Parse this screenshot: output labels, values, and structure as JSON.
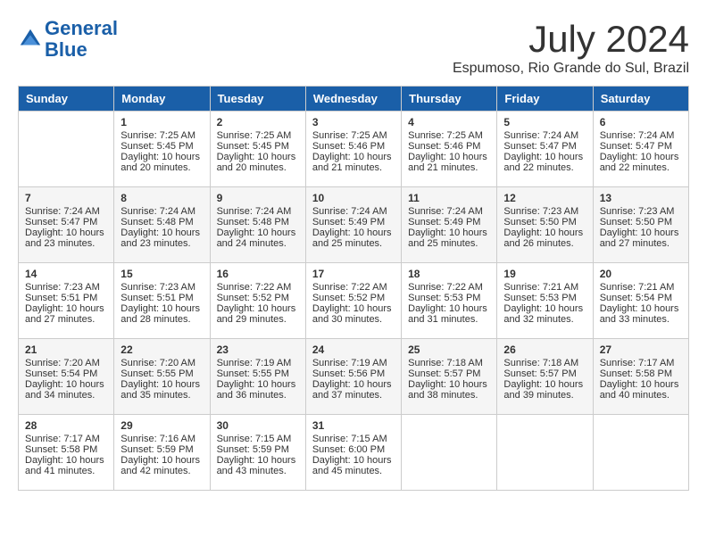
{
  "header": {
    "logo_line1": "General",
    "logo_line2": "Blue",
    "month_year": "July 2024",
    "location": "Espumoso, Rio Grande do Sul, Brazil"
  },
  "weekdays": [
    "Sunday",
    "Monday",
    "Tuesday",
    "Wednesday",
    "Thursday",
    "Friday",
    "Saturday"
  ],
  "weeks": [
    [
      {
        "day": "",
        "content": ""
      },
      {
        "day": "1",
        "content": "Sunrise: 7:25 AM\nSunset: 5:45 PM\nDaylight: 10 hours\nand 20 minutes."
      },
      {
        "day": "2",
        "content": "Sunrise: 7:25 AM\nSunset: 5:45 PM\nDaylight: 10 hours\nand 20 minutes."
      },
      {
        "day": "3",
        "content": "Sunrise: 7:25 AM\nSunset: 5:46 PM\nDaylight: 10 hours\nand 21 minutes."
      },
      {
        "day": "4",
        "content": "Sunrise: 7:25 AM\nSunset: 5:46 PM\nDaylight: 10 hours\nand 21 minutes."
      },
      {
        "day": "5",
        "content": "Sunrise: 7:24 AM\nSunset: 5:47 PM\nDaylight: 10 hours\nand 22 minutes."
      },
      {
        "day": "6",
        "content": "Sunrise: 7:24 AM\nSunset: 5:47 PM\nDaylight: 10 hours\nand 22 minutes."
      }
    ],
    [
      {
        "day": "7",
        "content": "Sunrise: 7:24 AM\nSunset: 5:47 PM\nDaylight: 10 hours\nand 23 minutes."
      },
      {
        "day": "8",
        "content": "Sunrise: 7:24 AM\nSunset: 5:48 PM\nDaylight: 10 hours\nand 23 minutes."
      },
      {
        "day": "9",
        "content": "Sunrise: 7:24 AM\nSunset: 5:48 PM\nDaylight: 10 hours\nand 24 minutes."
      },
      {
        "day": "10",
        "content": "Sunrise: 7:24 AM\nSunset: 5:49 PM\nDaylight: 10 hours\nand 25 minutes."
      },
      {
        "day": "11",
        "content": "Sunrise: 7:24 AM\nSunset: 5:49 PM\nDaylight: 10 hours\nand 25 minutes."
      },
      {
        "day": "12",
        "content": "Sunrise: 7:23 AM\nSunset: 5:50 PM\nDaylight: 10 hours\nand 26 minutes."
      },
      {
        "day": "13",
        "content": "Sunrise: 7:23 AM\nSunset: 5:50 PM\nDaylight: 10 hours\nand 27 minutes."
      }
    ],
    [
      {
        "day": "14",
        "content": "Sunrise: 7:23 AM\nSunset: 5:51 PM\nDaylight: 10 hours\nand 27 minutes."
      },
      {
        "day": "15",
        "content": "Sunrise: 7:23 AM\nSunset: 5:51 PM\nDaylight: 10 hours\nand 28 minutes."
      },
      {
        "day": "16",
        "content": "Sunrise: 7:22 AM\nSunset: 5:52 PM\nDaylight: 10 hours\nand 29 minutes."
      },
      {
        "day": "17",
        "content": "Sunrise: 7:22 AM\nSunset: 5:52 PM\nDaylight: 10 hours\nand 30 minutes."
      },
      {
        "day": "18",
        "content": "Sunrise: 7:22 AM\nSunset: 5:53 PM\nDaylight: 10 hours\nand 31 minutes."
      },
      {
        "day": "19",
        "content": "Sunrise: 7:21 AM\nSunset: 5:53 PM\nDaylight: 10 hours\nand 32 minutes."
      },
      {
        "day": "20",
        "content": "Sunrise: 7:21 AM\nSunset: 5:54 PM\nDaylight: 10 hours\nand 33 minutes."
      }
    ],
    [
      {
        "day": "21",
        "content": "Sunrise: 7:20 AM\nSunset: 5:54 PM\nDaylight: 10 hours\nand 34 minutes."
      },
      {
        "day": "22",
        "content": "Sunrise: 7:20 AM\nSunset: 5:55 PM\nDaylight: 10 hours\nand 35 minutes."
      },
      {
        "day": "23",
        "content": "Sunrise: 7:19 AM\nSunset: 5:55 PM\nDaylight: 10 hours\nand 36 minutes."
      },
      {
        "day": "24",
        "content": "Sunrise: 7:19 AM\nSunset: 5:56 PM\nDaylight: 10 hours\nand 37 minutes."
      },
      {
        "day": "25",
        "content": "Sunrise: 7:18 AM\nSunset: 5:57 PM\nDaylight: 10 hours\nand 38 minutes."
      },
      {
        "day": "26",
        "content": "Sunrise: 7:18 AM\nSunset: 5:57 PM\nDaylight: 10 hours\nand 39 minutes."
      },
      {
        "day": "27",
        "content": "Sunrise: 7:17 AM\nSunset: 5:58 PM\nDaylight: 10 hours\nand 40 minutes."
      }
    ],
    [
      {
        "day": "28",
        "content": "Sunrise: 7:17 AM\nSunset: 5:58 PM\nDaylight: 10 hours\nand 41 minutes."
      },
      {
        "day": "29",
        "content": "Sunrise: 7:16 AM\nSunset: 5:59 PM\nDaylight: 10 hours\nand 42 minutes."
      },
      {
        "day": "30",
        "content": "Sunrise: 7:15 AM\nSunset: 5:59 PM\nDaylight: 10 hours\nand 43 minutes."
      },
      {
        "day": "31",
        "content": "Sunrise: 7:15 AM\nSunset: 6:00 PM\nDaylight: 10 hours\nand 45 minutes."
      },
      {
        "day": "",
        "content": ""
      },
      {
        "day": "",
        "content": ""
      },
      {
        "day": "",
        "content": ""
      }
    ]
  ]
}
